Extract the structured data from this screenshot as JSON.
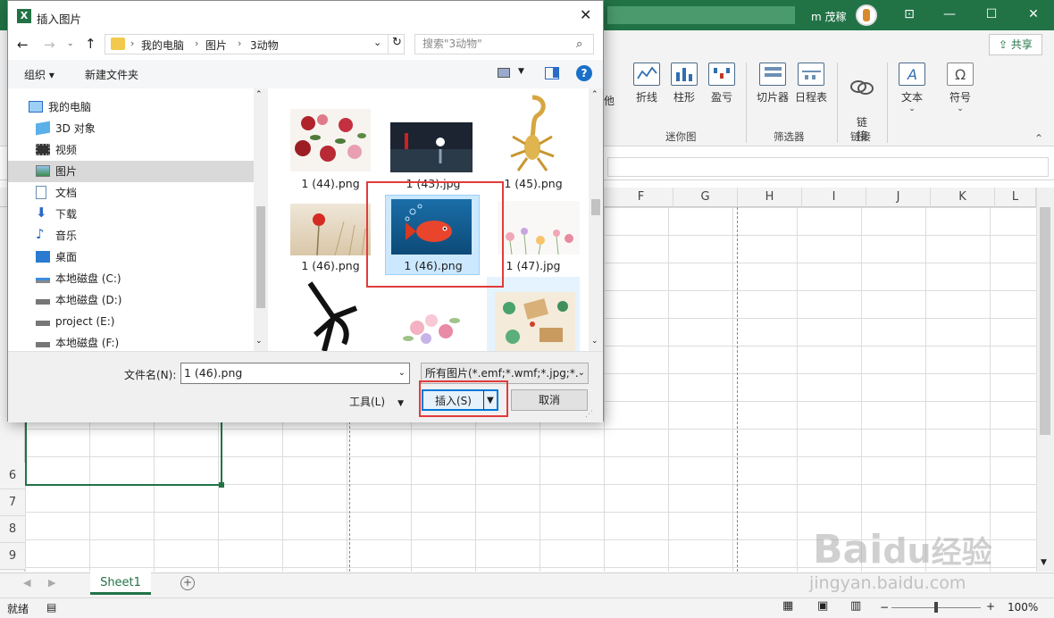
{
  "excel": {
    "user": "m 茂稼",
    "share_label": "共享",
    "ribbon": {
      "buttons": [
        {
          "label": "折线"
        },
        {
          "label": "柱形"
        },
        {
          "label": "盈亏"
        },
        {
          "label": "切片器"
        },
        {
          "label": "日程表"
        },
        {
          "label": "链\n接"
        },
        {
          "label": "文本"
        },
        {
          "label": "符号"
        }
      ],
      "partial_label": "他",
      "groups": {
        "sparklines": "迷你图",
        "filters": "筛选器",
        "links": "链接"
      }
    },
    "columns": [
      "F",
      "G",
      "H",
      "I",
      "J",
      "K",
      "L"
    ],
    "rows": [
      "6",
      "7",
      "8",
      "9"
    ],
    "sheet_tab": "Sheet1",
    "status": {
      "ready": "就绪",
      "zoom": "100%"
    }
  },
  "dialog": {
    "title": "插入图片",
    "breadcrumb": [
      "我的电脑",
      "图片",
      "3动物"
    ],
    "search_placeholder": "搜索\"3动物\"",
    "organize_label": "组织 ▾",
    "new_folder_label": "新建文件夹",
    "tree": [
      {
        "label": "我的电脑",
        "icon": "computer-icon"
      },
      {
        "label": "3D 对象",
        "icon": "cube-icon"
      },
      {
        "label": "视频",
        "icon": "video-icon"
      },
      {
        "label": "图片",
        "icon": "pictures-icon",
        "selected": true
      },
      {
        "label": "文档",
        "icon": "document-icon"
      },
      {
        "label": "下载",
        "icon": "download-icon"
      },
      {
        "label": "音乐",
        "icon": "music-icon"
      },
      {
        "label": "桌面",
        "icon": "desktop-icon"
      },
      {
        "label": "本地磁盘 (C:)",
        "icon": "drive-icon"
      },
      {
        "label": "本地磁盘 (D:)",
        "icon": "drive-icon"
      },
      {
        "label": "project (E:)",
        "icon": "drive-icon"
      },
      {
        "label": "本地磁盘 (F:)",
        "icon": "drive-icon"
      }
    ],
    "files": [
      {
        "name": "1 (44).png",
        "thumb": "roses"
      },
      {
        "name": "1 (43).jpg",
        "thumb": "night-lake"
      },
      {
        "name": "1 (45).png",
        "thumb": "golden-scorpion"
      },
      {
        "name": "1 (46).png",
        "thumb": "red-flower"
      },
      {
        "name": "1 (46).png",
        "thumb": "fish",
        "selected": true
      },
      {
        "name": "1 (47).jpg",
        "thumb": "watercolor-flowers"
      },
      {
        "name": "",
        "thumb": "swordfish"
      },
      {
        "name": "",
        "thumb": "pink-flowers"
      },
      {
        "name": "",
        "thumb": "table-items"
      }
    ],
    "filename_label": "文件名(N):",
    "filename_value": "1 (46).png",
    "filetype_value": "所有图片(*.emf;*.wmf;*.jpg;*.j",
    "tools_label": "工具(L)",
    "insert_label": "插入(S)",
    "cancel_label": "取消"
  },
  "watermark": {
    "line1": "Bai",
    "line2": "du",
    "line3": "经验",
    "url": "jingyan.baidu.com"
  }
}
